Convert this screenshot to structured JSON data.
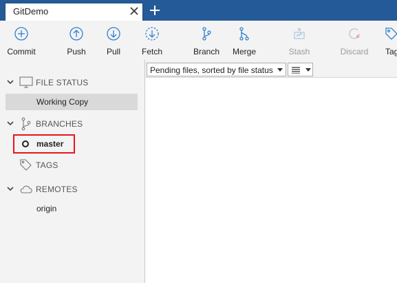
{
  "window": {
    "tab_title": "GitDemo"
  },
  "toolbar": {
    "commit": "Commit",
    "push": "Push",
    "pull": "Pull",
    "fetch": "Fetch",
    "branch": "Branch",
    "merge": "Merge",
    "stash": "Stash",
    "discard": "Discard",
    "tag": "Tag"
  },
  "sidebar": {
    "file_status": {
      "title": "FILE STATUS",
      "items": [
        "Working Copy"
      ]
    },
    "branches": {
      "title": "BRANCHES",
      "items": [
        "master"
      ]
    },
    "tags": {
      "title": "TAGS"
    },
    "remotes": {
      "title": "REMOTES",
      "items": [
        "origin"
      ]
    }
  },
  "main": {
    "filter_combo": "Pending files, sorted by file status"
  },
  "colors": {
    "titlebar": "#235a97",
    "icon_blue": "#2f7fd1",
    "highlight_box": "#e8141b",
    "selected_row": "#d9d9d9"
  }
}
